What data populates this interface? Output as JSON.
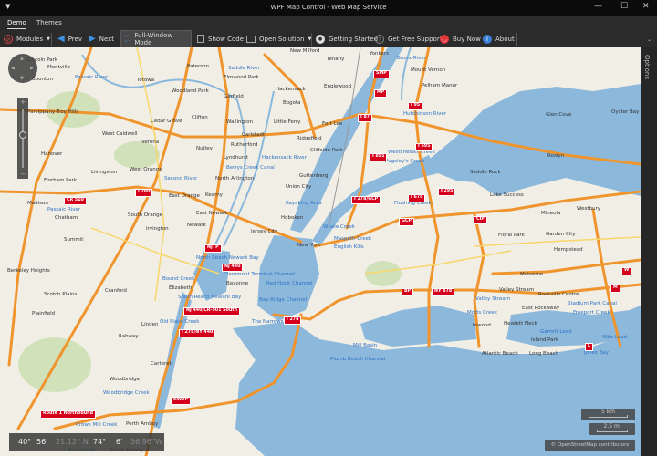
{
  "window": {
    "title": "WPF Map Control - Web Map Service",
    "menu_icon": "triangle-down",
    "minimize": "—",
    "maximize": "☐",
    "close": "✕"
  },
  "tabs": [
    {
      "label": "Demo",
      "active": true
    },
    {
      "label": "Themes",
      "active": false
    }
  ],
  "toolbar": {
    "modules": "Modules",
    "prev": "Prev",
    "next": "Next",
    "full_window": "Full-Window Mode",
    "show_code": "Show Code",
    "open_solution": "Open Solution",
    "getting_started": "Getting Started",
    "support": "Get Free Support",
    "buy_now": "Buy Now",
    "about": "About"
  },
  "options_label": "Options",
  "colors": {
    "water": "#8cb8dc",
    "land": "#f1eee6",
    "road": "#f0952d",
    "shield": "#d5001c",
    "water_label": "#2f73c4"
  },
  "map": {
    "towns": [
      "Lincoln Park",
      "Montville",
      "Boonton",
      "Parsippany-Troy Hills",
      "Hanover",
      "Florham Park",
      "Totowa",
      "Woodland Park",
      "Paterson",
      "Clifton",
      "Cedar Grove",
      "West Caldwell",
      "Verona",
      "Livingston",
      "West Orange",
      "Nutley",
      "Wallington",
      "Garfield",
      "Elmwood Park",
      "Hackensack",
      "Bogota",
      "Little Ferry",
      "Carlstadt",
      "Rutherford",
      "Lyndhurst",
      "North Arlington",
      "Ridgefield",
      "Cliffside Park",
      "Englewood",
      "Tenafly",
      "New Milford",
      "Fort Lee",
      "Guttenberg",
      "Union City",
      "Yonkers",
      "Mount Vernon",
      "Pelham Manor",
      "East Orange",
      "Kearny",
      "East Newark",
      "Newark",
      "South Orange",
      "Irvington",
      "Jersey City",
      "Hoboken",
      "New York",
      "Summit",
      "Madison",
      "Chatham",
      "Berkeley Heights",
      "Scotch Plains",
      "Plainfield",
      "Cranford",
      "Elizabeth",
      "Bayonne",
      "Linden",
      "Rahway",
      "Carteret",
      "Woodbridge",
      "Perth Amboy",
      "South Amboy",
      "Mineola",
      "Westbury",
      "Floral Park",
      "Garden City",
      "Hempstead",
      "Malverne",
      "Valley Stream",
      "Rockville Centre",
      "East Rockaway",
      "Hewlett Neck",
      "Inwood",
      "Island Park",
      "Long Beach",
      "Atlantic Beach",
      "Glen Cove",
      "Oyster Bay",
      "Roslyn",
      "Saddle Rock",
      "Lake Success"
    ],
    "waters": [
      "Saddle River",
      "Passaic River",
      "Bronx River",
      "Hutchinson River",
      "Hackensack River",
      "Berrys Creek Canal",
      "Westchester Creek",
      "Pugsley's Creek",
      "Kayaking Area",
      "Flushing Creek",
      "Whale Creek",
      "Maspeth Creek",
      "English Kills",
      "North Reach Newark Bay",
      "Claremont Terminal Channel",
      "Red Hook Channel",
      "Bay Ridge Channel",
      "South Reach Newark Bay",
      "Bound Creek",
      "The Narrows",
      "Old Place Creek",
      "Plumb Beach Channel",
      "Mill Basin",
      "Valley Stream",
      "Motts Creek",
      "Stadium Park Canal",
      "Freeport Creek",
      "Garrett Lead",
      "Wife Lead",
      "Jones Bay",
      "Second River",
      "Passaic River",
      "Woodbridge Creek",
      "Crows Mill Creek",
      "Burt Creek"
    ],
    "shields": [
      "SMP",
      "MP",
      "I 87",
      "I 95",
      "I 895",
      "I 695",
      "I 278/GCP",
      "I 678",
      "I 295",
      "GCP",
      "CIP",
      "I 280",
      "CR 510",
      "NJTP",
      "NJ 440",
      "NJ 440/CR-501 South",
      "I 278/NY 440",
      "I 278",
      "BP",
      "NY 878",
      "W",
      "M",
      "L",
      "Route 1 Northbound",
      "KWVP"
    ]
  },
  "nav": {
    "up": "▲",
    "down": "▼",
    "left": "◀",
    "right": "▶",
    "zoom_in": "+",
    "zoom_out": "−",
    "zoom_level": 0.6
  },
  "coords": {
    "lat_deg": "40°",
    "lat_min": "56'",
    "lat_sec": "21.12'' N",
    "lon_deg": "74°",
    "lon_min": "6'",
    "lon_sec": "36.96''W"
  },
  "scale": {
    "km": "5 km",
    "mi": "2.5 mi"
  },
  "attribution": "© OpenStreetMap contributors"
}
